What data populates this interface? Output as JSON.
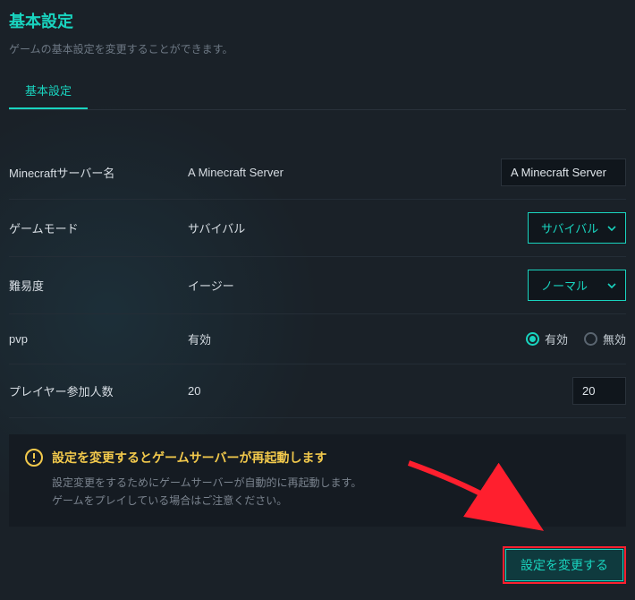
{
  "header": {
    "title": "基本設定",
    "subtitle": "ゲームの基本設定を変更することができます。"
  },
  "tabs": {
    "active": "基本設定"
  },
  "rows": {
    "serverName": {
      "label": "Minecraftサーバー名",
      "current": "A Minecraft Server",
      "value": "A Minecraft Server"
    },
    "gameMode": {
      "label": "ゲームモード",
      "current": "サバイバル",
      "value": "サバイバル"
    },
    "difficulty": {
      "label": "難易度",
      "current": "イージー",
      "value": "ノーマル"
    },
    "pvp": {
      "label": "pvp",
      "current": "有効",
      "options": {
        "enabled": "有効",
        "disabled": "無効"
      },
      "value": "enabled"
    },
    "maxPlayers": {
      "label": "プレイヤー参加人数",
      "current": "20",
      "value": "20"
    }
  },
  "notice": {
    "title": "設定を変更するとゲームサーバーが再起動します",
    "line1": "設定変更をするためにゲームサーバーが自動的に再起動します。",
    "line2": "ゲームをプレイしている場合はご注意ください。"
  },
  "actions": {
    "save": "設定を変更する"
  }
}
